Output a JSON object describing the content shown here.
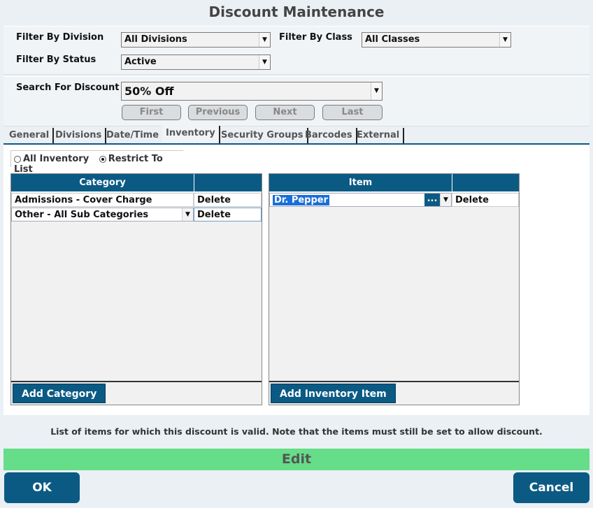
{
  "window": {
    "title": "Discount Maintenance"
  },
  "filters": {
    "division_label": "Filter By Division",
    "division_value": "All Divisions",
    "class_label": "Filter By Class",
    "class_value": "All Classes",
    "status_label": "Filter By Status",
    "status_value": "Active"
  },
  "search": {
    "label": "Search For Discount",
    "value": "50% Off",
    "nav": {
      "first": "First",
      "previous": "Previous",
      "next": "Next",
      "last": "Last"
    }
  },
  "tabs": [
    {
      "label": "General"
    },
    {
      "label": "Divisions"
    },
    {
      "label": "Date/Time"
    },
    {
      "label": "Inventory",
      "active": true
    },
    {
      "label": "Security Groups"
    },
    {
      "label": "Barcodes"
    },
    {
      "label": "External"
    }
  ],
  "inventory": {
    "radio_all": "All Inventory",
    "radio_restrict": "Restrict To List",
    "category_grid": {
      "header": "Category",
      "rows": [
        {
          "category": "Admissions - Cover Charge",
          "delete": "Delete"
        },
        {
          "category": "Other - All Sub Categories",
          "delete": "Delete"
        }
      ],
      "add_button": "Add Category"
    },
    "item_grid": {
      "header": "Item",
      "rows": [
        {
          "item": "Dr. Pepper",
          "browse": "...",
          "delete": "Delete"
        }
      ],
      "add_button": "Add Inventory Item"
    }
  },
  "help_text": "List of items for which this discount is valid.  Note that the items must still be set to allow discount.",
  "mode": {
    "label": "Edit",
    "color": "#66dd88"
  },
  "footer": {
    "ok": "OK",
    "cancel": "Cancel"
  },
  "colors": {
    "accent": "#0b5a84"
  }
}
